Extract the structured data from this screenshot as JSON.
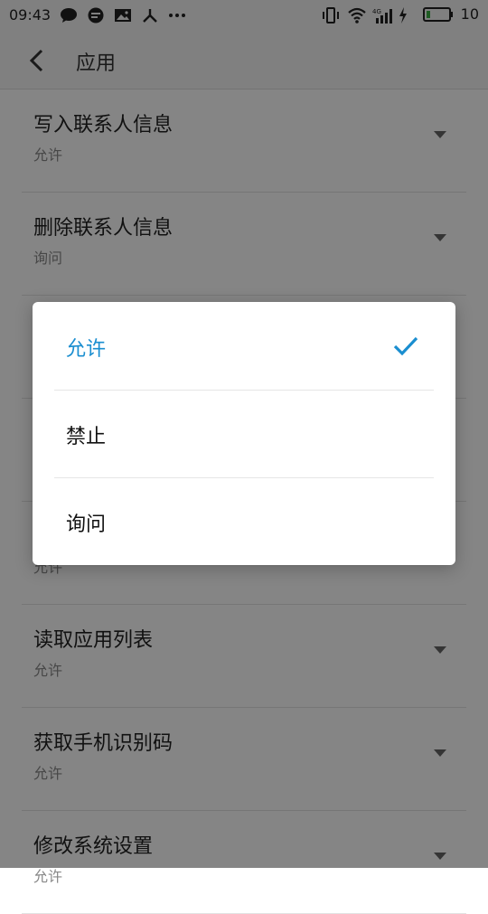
{
  "status_bar": {
    "time": "09:43",
    "battery_level": "10",
    "left_icons": [
      "chat-bubble-icon",
      "message-icon",
      "image-icon",
      "share-icon",
      "more-icon"
    ],
    "right_icons": [
      "vibrate-icon",
      "wifi-icon",
      "signal-4g-icon",
      "charging-icon",
      "battery-icon"
    ]
  },
  "header": {
    "title": "应用",
    "back_icon": "back-arrow-icon"
  },
  "permissions": [
    {
      "title": "写入联系人信息",
      "value": "允许"
    },
    {
      "title": "删除联系人信息",
      "value": "询问"
    },
    {
      "title": "",
      "value": ""
    },
    {
      "title": "",
      "value": ""
    },
    {
      "title": "",
      "value": "允许"
    },
    {
      "title": "读取应用列表",
      "value": "允许"
    },
    {
      "title": "获取手机识别码",
      "value": "允许"
    },
    {
      "title": "修改系统设置",
      "value": "允许"
    }
  ],
  "dialog": {
    "options": [
      {
        "label": "允许",
        "selected": true
      },
      {
        "label": "禁止",
        "selected": false
      },
      {
        "label": "询问",
        "selected": false
      }
    ],
    "check_icon": "checkmark-icon",
    "accent_color": "#1a8ed0"
  }
}
